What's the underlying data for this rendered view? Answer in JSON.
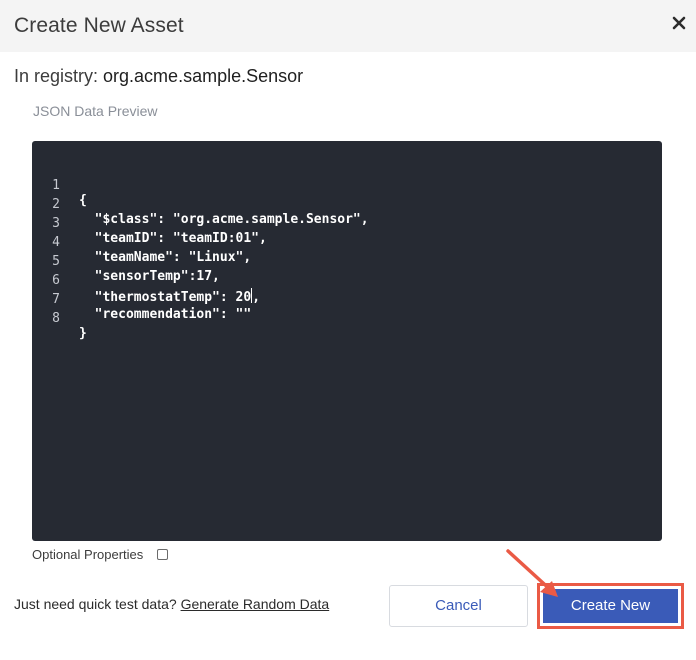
{
  "dialog": {
    "title": "Create New Asset",
    "registry_prefix": "In registry: ",
    "registry_name": "org.acme.sample.Sensor",
    "preview_label": "JSON Data Preview"
  },
  "editor": {
    "lines": [
      {
        "num": "1",
        "text": "{"
      },
      {
        "num": "2",
        "text": "  \"$class\": \"org.acme.sample.Sensor\","
      },
      {
        "num": "3",
        "text": "  \"teamID\": \"teamID:01\","
      },
      {
        "num": "4",
        "text": "  \"teamName\": \"Linux\","
      },
      {
        "num": "5",
        "text": "  \"sensorTemp\":17,"
      },
      {
        "num": "6",
        "text_before_cursor": "  \"thermostatTemp\": 20",
        "text_after_cursor": ","
      },
      {
        "num": "7",
        "text": "  \"recommendation\": \"\""
      },
      {
        "num": "8",
        "text": "}"
      }
    ]
  },
  "options": {
    "optional_label": "Optional Properties",
    "optional_checked": false
  },
  "footer": {
    "quick_text": "Just need quick test data? ",
    "quick_link": "Generate Random Data",
    "cancel_label": "Cancel",
    "create_label": "Create New"
  },
  "colors": {
    "accent": "#3a5bb8",
    "highlight": "#ea5a45",
    "editor_bg": "#262a33"
  },
  "icons": {
    "close": "close-icon",
    "arrow": "annotation-arrow-icon"
  }
}
